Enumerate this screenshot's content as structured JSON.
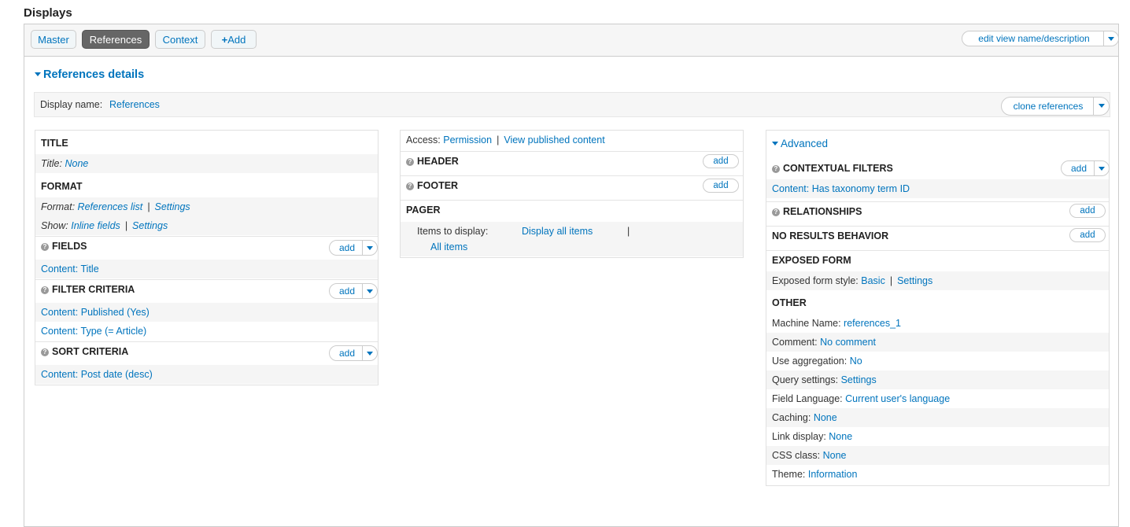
{
  "heading": "Displays",
  "tabs": {
    "master": "Master",
    "references": "References",
    "context": "Context",
    "add": "Add"
  },
  "edit_view": "edit view name/description",
  "details_title": "References details",
  "display_name": {
    "label": "Display name:",
    "value": "References"
  },
  "clone_button": "clone references",
  "left": {
    "title_head": "TITLE",
    "title_label": "Title:",
    "title_value": "None",
    "format_head": "FORMAT",
    "format_label": "Format:",
    "format_value": "References list",
    "format_settings": "Settings",
    "show_label": "Show:",
    "show_value": "Inline fields",
    "show_settings": "Settings",
    "fields_head": "FIELDS",
    "fields_items": [
      "Content: Title"
    ],
    "filter_head": "FILTER CRITERIA",
    "filter_items": [
      "Content: Published (Yes)",
      "Content: Type (= Article)"
    ],
    "sort_head": "SORT CRITERIA",
    "sort_items": [
      "Content: Post date (desc)"
    ],
    "add_label": "add"
  },
  "middle": {
    "access_label": "Access:",
    "access_value": "Permission",
    "access_detail": "View published content",
    "header_head": "HEADER",
    "footer_head": "FOOTER",
    "pager_head": "PAGER",
    "items_label": "Items to display:",
    "items_value": "Display all items",
    "items_pipe": "|",
    "all_items": "All items",
    "add_label": "add"
  },
  "right": {
    "advanced": "Advanced",
    "contextual_head": "CONTEXTUAL FILTERS",
    "contextual_item": "Content: Has taxonomy term ID",
    "relationships_head": "RELATIONSHIPS",
    "no_results_head": "NO RESULTS BEHAVIOR",
    "exposed_head": "EXPOSED FORM",
    "exposed_label": "Exposed form style:",
    "exposed_value": "Basic",
    "exposed_settings": "Settings",
    "other_head": "OTHER",
    "other_rows": [
      {
        "label": "Machine Name:",
        "value": "references_1"
      },
      {
        "label": "Comment:",
        "value": "No comment"
      },
      {
        "label": "Use aggregation:",
        "value": "No"
      },
      {
        "label": "Query settings:",
        "value": "Settings"
      },
      {
        "label": "Field Language:",
        "value": "Current user's language"
      },
      {
        "label": "Caching:",
        "value": "None"
      },
      {
        "label": "Link display:",
        "value": "None"
      },
      {
        "label": "CSS class:",
        "value": "None"
      },
      {
        "label": "Theme:",
        "value": "Information"
      }
    ],
    "add_label": "add"
  }
}
